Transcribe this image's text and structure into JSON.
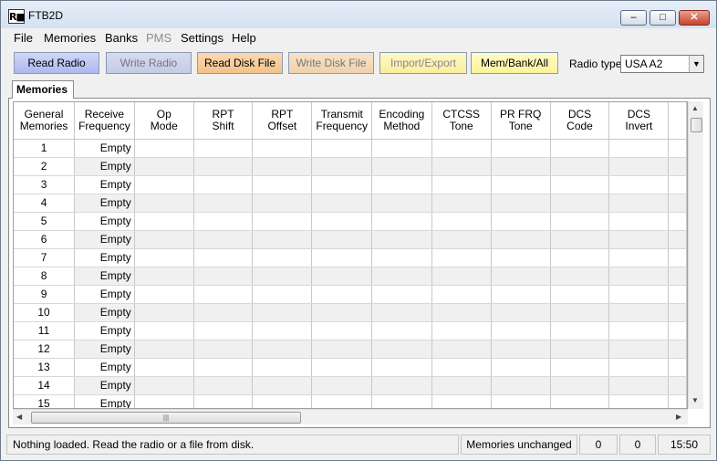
{
  "window": {
    "title": "FTB2D",
    "icon_text": "R■",
    "controls": {
      "minimize": "–",
      "maximize": "□",
      "close": "✕"
    }
  },
  "menu": [
    {
      "label": "File",
      "enabled": true
    },
    {
      "label": "Memories",
      "enabled": true
    },
    {
      "label": "Banks",
      "enabled": true
    },
    {
      "label": "PMS",
      "enabled": false
    },
    {
      "label": "Settings",
      "enabled": true
    },
    {
      "label": "Help",
      "enabled": true
    }
  ],
  "toolbar": {
    "read_radio": "Read Radio",
    "write_radio": "Write Radio",
    "read_disk_file": "Read Disk File",
    "write_disk_file": "Write Disk File",
    "import_export": "Import/Export",
    "mem_bank_all": "Mem/Bank/All",
    "radio_type_label": "Radio type",
    "radio_type_value": "USA A2"
  },
  "tabs": {
    "memories": "Memories"
  },
  "grid": {
    "columns": [
      [
        "General",
        "Memories"
      ],
      [
        "Receive",
        "Frequency"
      ],
      [
        "Op",
        "Mode"
      ],
      [
        "RPT",
        "Shift"
      ],
      [
        "RPT",
        "Offset"
      ],
      [
        "Transmit",
        "Frequency"
      ],
      [
        "Encoding",
        "Method"
      ],
      [
        "CTCSS",
        "Tone"
      ],
      [
        "PR FRQ",
        "Tone"
      ],
      [
        "DCS",
        "Code"
      ],
      [
        "DCS",
        "Invert"
      ]
    ],
    "rows": [
      {
        "num": "1",
        "receive": "Empty"
      },
      {
        "num": "2",
        "receive": "Empty"
      },
      {
        "num": "3",
        "receive": "Empty"
      },
      {
        "num": "4",
        "receive": "Empty"
      },
      {
        "num": "5",
        "receive": "Empty"
      },
      {
        "num": "6",
        "receive": "Empty"
      },
      {
        "num": "7",
        "receive": "Empty"
      },
      {
        "num": "8",
        "receive": "Empty"
      },
      {
        "num": "9",
        "receive": "Empty"
      },
      {
        "num": "10",
        "receive": "Empty"
      },
      {
        "num": "11",
        "receive": "Empty"
      },
      {
        "num": "12",
        "receive": "Empty"
      },
      {
        "num": "13",
        "receive": "Empty"
      },
      {
        "num": "14",
        "receive": "Empty"
      },
      {
        "num": "15",
        "receive": "Empty"
      }
    ]
  },
  "status": {
    "message": "Nothing loaded. Read the radio or a file from disk.",
    "memories_state": "Memories unchanged",
    "count_a": "0",
    "count_b": "0",
    "time": "15:50"
  }
}
